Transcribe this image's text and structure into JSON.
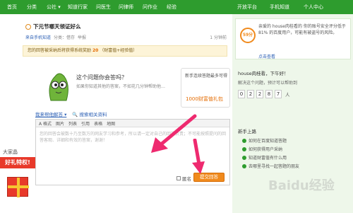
{
  "nav": {
    "items": [
      "首页",
      "分类",
      "公社 ▾",
      "知道行家",
      "问医生",
      "问律师",
      "问作业",
      "经验"
    ],
    "right_items": [
      "开放平台",
      "手机知道",
      "个人中心"
    ]
  },
  "question": {
    "title": "下元节哪天领证好么",
    "meta_from": "来自手机知道",
    "meta_category": "分类：借存",
    "meta_report": "举报",
    "meta_time": "1 分钟前",
    "notice_prefix": "您的回答被采纳后将获得系统奖励",
    "notice_num": "20",
    "notice_suffix": "（财富值+经验值）"
  },
  "prompt": {
    "title": "这个问题你会答吗？",
    "sub": "如果你知道其他的答案，不如花几分钟帮助他…",
    "bubble_text": "新手连续答题最多可得",
    "bubble_wealth": "1000财富值礼包"
  },
  "editor": {
    "tab1": "我来帮他解答 ▾",
    "tab2": "搜索相关资料",
    "toolbar": [
      "A 格式",
      "图片",
      "列表",
      "引用",
      "表格",
      "地图"
    ],
    "placeholder": "您的回答会被数十乃至数万的网友学习和参考，所以请一定对自己的回答负责；不可能按照提问的回答客观、详细和有效的答案，谢谢！"
  },
  "submit": {
    "anon": "匿名",
    "button": "提交回答"
  },
  "promo": {
    "title": "大家晶",
    "banner": "好礼特权!"
  },
  "right": {
    "badge": "59分",
    "panel1_text": "亲爱的 house肉桂看的 你的账号安全评分低于 81% 的百度用户，可能有被盗号的风险。",
    "panel1_pct": "81%",
    "panel1_link": "点击查看",
    "greeting": "house肉桂看，下午好！",
    "solved": "解决这个问题，预计可以帮助到",
    "digits": [
      "0",
      "2",
      "2",
      "8",
      "7"
    ],
    "unit": "人",
    "guide_title": "新手上路",
    "guides": [
      "如何在百度知道答题",
      "如何获得用户采纳",
      "知道财富值有什么用",
      "去哪里寻找一起答题的朋友"
    ]
  },
  "watermark": "Baidu经验",
  "colors": {
    "nav_green": "#2e9c2e",
    "submit_orange": "#f08a1d",
    "arrow_pink": "#ee2a6f"
  }
}
